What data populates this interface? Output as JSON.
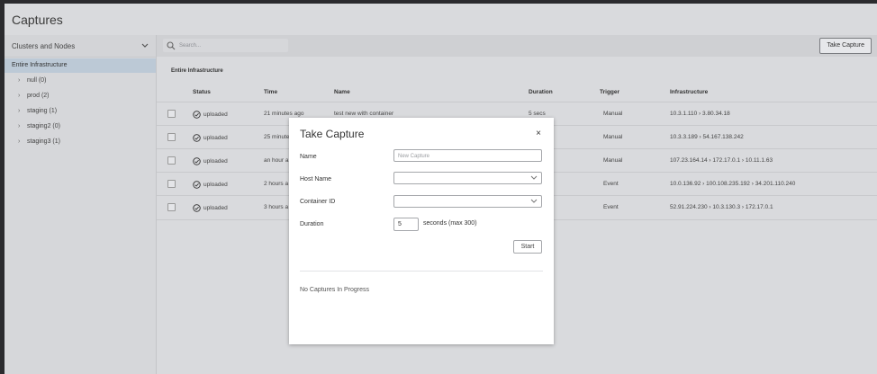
{
  "page": {
    "title": "Captures"
  },
  "sidebar": {
    "header": "Clusters and Nodes",
    "active": "Entire Infrastructure",
    "items": [
      {
        "label": "null (0)"
      },
      {
        "label": "prod (2)"
      },
      {
        "label": "staging (1)"
      },
      {
        "label": "staging2 (0)"
      },
      {
        "label": "staging3 (1)"
      }
    ]
  },
  "toolbar": {
    "search_placeholder": "Search...",
    "take_capture_label": "Take Capture"
  },
  "main": {
    "breadcrumb": "Entire Infrastructure"
  },
  "table": {
    "headers": [
      "Status",
      "Time",
      "Name",
      "Duration",
      "Trigger",
      "Infrastructure"
    ],
    "rows": [
      {
        "status": "uploaded",
        "time": "21 minutes ago",
        "name": "test new with container",
        "duration": "5 secs",
        "trigger": "Manual",
        "infra": "10.3.1.110 › 3.80.34.18"
      },
      {
        "status": "uploaded",
        "time": "25 minute",
        "name": "",
        "duration": "",
        "trigger": "Manual",
        "infra": "10.3.3.189 › 54.167.138.242"
      },
      {
        "status": "uploaded",
        "time": "an hour a",
        "name": "",
        "duration": "",
        "trigger": "Manual",
        "infra": "107.23.164.14 › 172.17.0.1 › 10.11.1.63"
      },
      {
        "status": "uploaded",
        "time": "2 hours a",
        "name": "",
        "duration": "",
        "trigger": "Event",
        "infra": "10.0.136.92 › 100.108.235.192 › 34.201.110.240"
      },
      {
        "status": "uploaded",
        "time": "3 hours a",
        "name": "",
        "duration": "",
        "trigger": "Event",
        "infra": "52.91.224.230 › 10.3.130.3 › 172.17.0.1"
      }
    ]
  },
  "modal": {
    "title": "Take Capture",
    "close": "×",
    "name_label": "Name",
    "name_placeholder": "New Capture",
    "host_label": "Host Name",
    "container_label": "Container ID",
    "duration_label": "Duration",
    "duration_value": "5",
    "duration_suffix": "seconds (max 300)",
    "start_label": "Start",
    "progress_text": "No Captures In Progress"
  }
}
